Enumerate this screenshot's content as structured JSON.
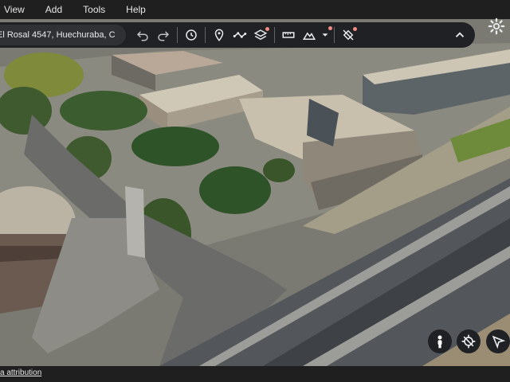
{
  "menu": [
    "View",
    "Add",
    "Tools",
    "Help"
  ],
  "search": {
    "value": "El Rosal 4547, Huechuraba, C"
  },
  "footer": {
    "attribution": "a attribution"
  },
  "icons": [
    "undo-icon",
    "redo-icon",
    "history-icon",
    "pin-icon",
    "path-icon",
    "layers-icon",
    "ruler-icon",
    "elevation-icon",
    "chevron-down-icon",
    "no-satellite-icon",
    "chevron-up-icon",
    "gear-icon",
    "pegman-icon",
    "compass-reset-icon",
    "navigate-icon"
  ],
  "colors": {
    "toolbar": "#202124",
    "accent": "#1a73e8",
    "badge": "#f28b82"
  }
}
